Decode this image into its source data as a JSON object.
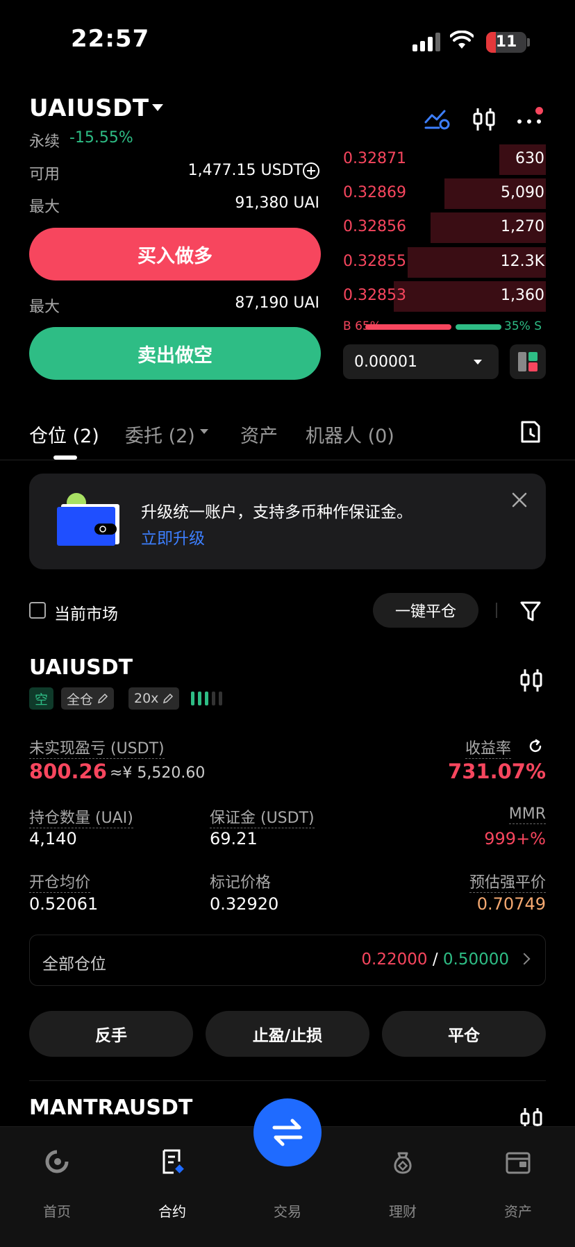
{
  "status_bar": {
    "time": "22:57",
    "battery": "11"
  },
  "header": {
    "symbol": "UAIUSDT",
    "contract_type": "永续",
    "change": "-15.55%"
  },
  "trade_panel": {
    "available_label": "可用",
    "available_value": "1,477.15 USDT",
    "max_label": "最大",
    "max_long_value": "91,380 UAI",
    "buy_button": "买入做多",
    "max_short_value": "87,190 UAI",
    "sell_button": "卖出做空"
  },
  "order_book": {
    "asks": [
      {
        "price": "0.32871",
        "qty": "630",
        "depth": 0.23
      },
      {
        "price": "0.32869",
        "qty": "5,090",
        "depth": 0.5
      },
      {
        "price": "0.32856",
        "qty": "1,270",
        "depth": 0.57
      },
      {
        "price": "0.32855",
        "qty": "12.3K",
        "depth": 0.68
      },
      {
        "price": "0.32853",
        "qty": "1,360",
        "depth": 0.75
      }
    ],
    "buy_ratio_label": "B 65%",
    "sell_ratio_label": "35% S",
    "buy_ratio": 0.65,
    "precision": "0.00001"
  },
  "tabs": [
    {
      "label": "仓位 (2)",
      "active": true
    },
    {
      "label": "委托 (2)",
      "active": false
    },
    {
      "label": "资产",
      "active": false
    },
    {
      "label": "机器人 (0)",
      "active": false
    }
  ],
  "banner": {
    "text": "升级统一账户，支持多币种作保证金。",
    "link": "立即升级"
  },
  "filter": {
    "current_market_label": "当前市场",
    "close_all_button": "一键平仓"
  },
  "position": {
    "symbol": "UAIUSDT",
    "side_tag": "空",
    "margin_mode_tag": "全仓",
    "leverage_tag": "20x",
    "unrealized_pnl_label": "未实现盈亏 (USDT)",
    "unrealized_pnl": "800.26",
    "unrealized_pnl_cny": "≈¥ 5,520.60",
    "roe_label": "收益率",
    "roe": "731.07%",
    "size_label": "持仓数量 (UAI)",
    "size": "4,140",
    "margin_label": "保证金 (USDT)",
    "margin": "69.21",
    "mmr_label": "MMR",
    "mmr": "999+%",
    "entry_label": "开仓均价",
    "entry": "0.52061",
    "mark_label": "标记价格",
    "mark": "0.32920",
    "liq_label": "预估强平价",
    "liq": "0.70749",
    "all_positions_label": "全部仓位",
    "tp_value": "0.22000",
    "separator": "/",
    "sl_value": "0.50000",
    "actions": [
      "反手",
      "止盈/止损",
      "平仓"
    ]
  },
  "position2": {
    "symbol": "MANTRAUSDT"
  },
  "bottom_nav": [
    {
      "label": "首页",
      "icon": "home-icon",
      "active": false
    },
    {
      "label": "合约",
      "icon": "futures-icon",
      "active": true
    },
    {
      "label": "交易",
      "icon": "trade-swap-icon",
      "active": false
    },
    {
      "label": "理财",
      "icon": "earn-icon",
      "active": false
    },
    {
      "label": "资产",
      "icon": "wallet-icon",
      "active": false
    }
  ],
  "colors": {
    "red": "#f7465e",
    "green": "#2ebd85",
    "blue": "#1f6bff",
    "orange": "#f5a971",
    "background": "#000000"
  }
}
